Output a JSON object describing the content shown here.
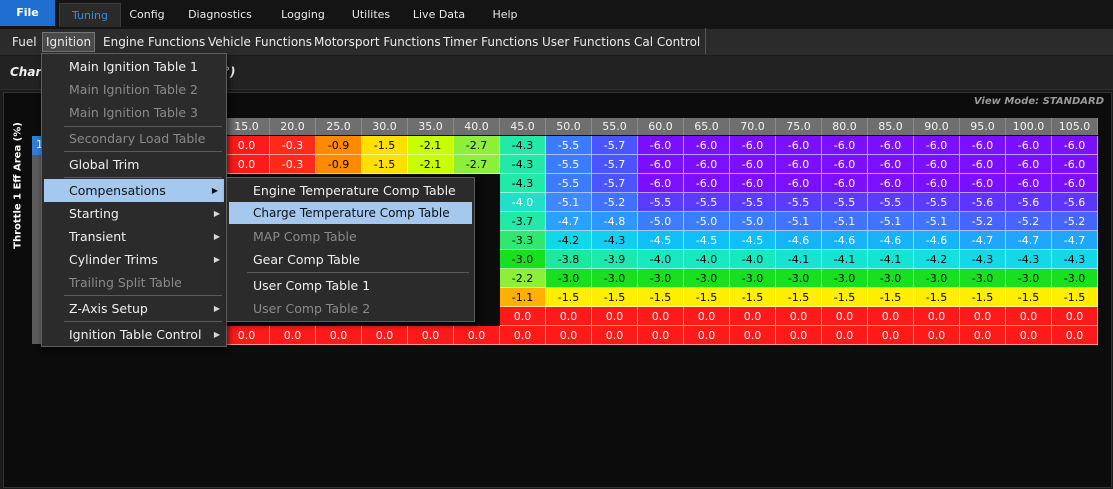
{
  "topbar": {
    "tabs": [
      {
        "label": "File",
        "name": "file"
      },
      {
        "label": "Tuning",
        "name": "tuning"
      },
      {
        "label": "Config",
        "name": "config"
      },
      {
        "label": "Diagnostics",
        "name": "diagnostics"
      },
      {
        "label": "Logging",
        "name": "logging"
      },
      {
        "label": "Utilites",
        "name": "utilites"
      },
      {
        "label": "Live Data",
        "name": "live-data"
      },
      {
        "label": "Help",
        "name": "help"
      }
    ],
    "active": "Tuning"
  },
  "submenu": {
    "items": [
      "Fuel",
      "Ignition",
      "Engine Functions",
      "Vehicle Functions",
      "Motorsport Functions",
      "Timer Functions",
      "User Functions",
      "Cal Control"
    ],
    "selected": "Ignition"
  },
  "header": {
    "title_partial": "Charg",
    "title_tail": "°)",
    "view_mode": "View Mode: STANDARD",
    "y_axis_label": "Throttle 1 Eff Area (%)"
  },
  "ignition_menu": {
    "items": [
      {
        "label": "Main Ignition Table 1",
        "disabled": false,
        "submenu": false
      },
      {
        "label": "Main Ignition Table 2",
        "disabled": true,
        "submenu": false
      },
      {
        "label": "Main Ignition Table 3",
        "disabled": true,
        "submenu": false
      },
      {
        "label": "Secondary Load Table",
        "disabled": true,
        "submenu": false
      },
      {
        "label": "Global Trim",
        "disabled": false,
        "submenu": false
      },
      {
        "label": "Compensations",
        "disabled": false,
        "submenu": true,
        "highlighted": true
      },
      {
        "label": "Starting",
        "disabled": false,
        "submenu": true
      },
      {
        "label": "Transient",
        "disabled": false,
        "submenu": true
      },
      {
        "label": "Cylinder Trims",
        "disabled": false,
        "submenu": true
      },
      {
        "label": "Trailing Split Table",
        "disabled": true,
        "submenu": false
      },
      {
        "label": "Z-Axis Setup",
        "disabled": false,
        "submenu": true
      },
      {
        "label": "Ignition Table Control",
        "disabled": false,
        "submenu": true
      }
    ]
  },
  "compensations_menu": {
    "items": [
      {
        "label": "Engine Temperature Comp Table",
        "disabled": false
      },
      {
        "label": "Charge Temperature Comp Table",
        "disabled": false,
        "highlighted": true
      },
      {
        "label": "MAP Comp Table",
        "disabled": true
      },
      {
        "label": "Gear Comp Table",
        "disabled": false
      },
      {
        "label": "User Comp Table 1",
        "disabled": false
      },
      {
        "label": "User Comp Table 2",
        "disabled": true
      }
    ]
  },
  "table": {
    "row_header_first": "1",
    "col_headers": [
      "15.0",
      "20.0",
      "25.0",
      "30.0",
      "35.0",
      "40.0",
      "45.0",
      "50.0",
      "55.0",
      "60.0",
      "65.0",
      "70.0",
      "75.0",
      "80.0",
      "85.0",
      "90.0",
      "95.0",
      "100.0",
      "105.0"
    ],
    "rows": [
      {
        "values": [
          "0.0",
          "-0.3",
          "-0.9",
          "-1.5",
          "-2.1",
          "-2.7",
          "-4.3",
          "-5.5",
          "-5.7",
          "-6.0",
          "-6.0",
          "-6.0",
          "-6.0",
          "-6.0",
          "-6.0",
          "-6.0",
          "-6.0",
          "-6.0",
          "-6.0"
        ],
        "colors": [
          "#ff1a1a",
          "#ff2a1a",
          "#ff8a00",
          "#ffe000",
          "#c7ff00",
          "#8cf03a",
          "#22e8a8",
          "#3b7cff",
          "#4a55ff",
          "#7a10ff",
          "#7a10ff",
          "#7a10ff",
          "#7a10ff",
          "#7a10ff",
          "#7a10ff",
          "#7a10ff",
          "#7a10ff",
          "#7a10ff",
          "#7a10ff"
        ]
      },
      {
        "values": [
          "0.0",
          "-0.3",
          "-0.9",
          "-1.5",
          "-2.1",
          "-2.7",
          "-4.3",
          "-5.5",
          "-5.7",
          "-6.0",
          "-6.0",
          "-6.0",
          "-6.0",
          "-6.0",
          "-6.0",
          "-6.0",
          "-6.0",
          "-6.0",
          "-6.0"
        ],
        "colors": [
          "#ff1a1a",
          "#ff2a1a",
          "#ff8a00",
          "#ffe000",
          "#c7ff00",
          "#8cf03a",
          "#22e8a8",
          "#3b7cff",
          "#4a55ff",
          "#7a10ff",
          "#7a10ff",
          "#7a10ff",
          "#7a10ff",
          "#7a10ff",
          "#7a10ff",
          "#7a10ff",
          "#7a10ff",
          "#7a10ff",
          "#7a10ff"
        ]
      },
      {
        "values": [
          "",
          "",
          "",
          "",
          "",
          "",
          "-4.3",
          "-5.5",
          "-5.7",
          "-6.0",
          "-6.0",
          "-6.0",
          "-6.0",
          "-6.0",
          "-6.0",
          "-6.0",
          "-6.0",
          "-6.0",
          "-6.0"
        ],
        "colors": [
          "",
          "",
          "",
          "",
          "",
          "",
          "#22e8a8",
          "#3b7cff",
          "#4a55ff",
          "#7a10ff",
          "#7a10ff",
          "#7a10ff",
          "#7a10ff",
          "#7a10ff",
          "#7a10ff",
          "#7a10ff",
          "#7a10ff",
          "#7a10ff",
          "#7a10ff"
        ]
      },
      {
        "values": [
          "",
          "",
          "",
          "",
          "",
          "",
          "-4.0",
          "-5.1",
          "-5.2",
          "-5.5",
          "-5.5",
          "-5.5",
          "-5.5",
          "-5.5",
          "-5.5",
          "-5.5",
          "-5.6",
          "-5.6",
          "-5.6"
        ],
        "colors": [
          "",
          "",
          "",
          "",
          "",
          "",
          "#20e0c8",
          "#3f88ff",
          "#4172ff",
          "#5a3cff",
          "#5a3cff",
          "#5a3cff",
          "#5a3cff",
          "#5a3cff",
          "#5a3cff",
          "#5a3cff",
          "#5c35ff",
          "#5c35ff",
          "#5c35ff"
        ]
      },
      {
        "values": [
          "",
          "",
          "",
          "",
          "",
          "",
          "-3.7",
          "-4.7",
          "-4.8",
          "-5.0",
          "-5.0",
          "-5.0",
          "-5.1",
          "-5.1",
          "-5.1",
          "-5.1",
          "-5.2",
          "-5.2",
          "-5.2"
        ],
        "colors": [
          "",
          "",
          "",
          "",
          "",
          "",
          "#22e8a8",
          "#2aa0ff",
          "#2c98ff",
          "#3a7dff",
          "#3a7dff",
          "#3a7dff",
          "#3f74ff",
          "#3f74ff",
          "#3f74ff",
          "#3f74ff",
          "#4466ff",
          "#4466ff",
          "#4466ff"
        ]
      },
      {
        "values": [
          "",
          "",
          "",
          "",
          "",
          "",
          "-3.3",
          "-4.2",
          "-4.3",
          "-4.5",
          "-4.5",
          "-4.5",
          "-4.6",
          "-4.6",
          "-4.6",
          "-4.6",
          "-4.7",
          "-4.7",
          "-4.7"
        ],
        "colors": [
          "",
          "",
          "",
          "",
          "",
          "",
          "#30e870",
          "#10d8e8",
          "#12cfef",
          "#10bff5",
          "#10bff5",
          "#10bff5",
          "#18b2f8",
          "#18b2f8",
          "#18b2f8",
          "#18b2f8",
          "#20a6fb",
          "#20a6fb",
          "#20a6fb"
        ]
      },
      {
        "values": [
          "",
          "",
          "",
          "",
          "",
          "",
          "-3.0",
          "-3.8",
          "-3.9",
          "-4.0",
          "-4.0",
          "-4.0",
          "-4.1",
          "-4.1",
          "-4.1",
          "-4.2",
          "-4.3",
          "-4.3",
          "-4.3"
        ],
        "colors": [
          "",
          "",
          "",
          "",
          "",
          "",
          "#18e020",
          "#1de8a0",
          "#1ce8b0",
          "#18e8c0",
          "#18e8c0",
          "#18e8c0",
          "#15e4d0",
          "#15e4d0",
          "#15e4d0",
          "#14e0e0",
          "#12d8e8",
          "#12d8e8",
          "#12d8e8"
        ]
      },
      {
        "values": [
          "",
          "",
          "",
          "",
          "",
          "",
          "-2.2",
          "-3.0",
          "-3.0",
          "-3.0",
          "-3.0",
          "-3.0",
          "-3.0",
          "-3.0",
          "-3.0",
          "-3.0",
          "-3.0",
          "-3.0",
          "-3.0"
        ],
        "colors": [
          "",
          "",
          "",
          "",
          "",
          "",
          "#8cf03a",
          "#18e020",
          "#18e020",
          "#18e020",
          "#18e020",
          "#18e020",
          "#18e020",
          "#18e020",
          "#18e020",
          "#18e020",
          "#18e020",
          "#18e020",
          "#18e020"
        ]
      },
      {
        "values": [
          "",
          "",
          "",
          "",
          "",
          "",
          "-1.1",
          "-1.5",
          "-1.5",
          "-1.5",
          "-1.5",
          "-1.5",
          "-1.5",
          "-1.5",
          "-1.5",
          "-1.5",
          "-1.5",
          "-1.5",
          "-1.5"
        ],
        "colors": [
          "",
          "",
          "",
          "",
          "",
          "",
          "#ffb000",
          "#ffee00",
          "#ffee00",
          "#ffee00",
          "#ffee00",
          "#ffee00",
          "#ffee00",
          "#ffee00",
          "#ffee00",
          "#ffee00",
          "#ffee00",
          "#ffee00",
          "#ffee00"
        ]
      },
      {
        "values": [
          "",
          "",
          "",
          "",
          "",
          "",
          "0.0",
          "0.0",
          "0.0",
          "0.0",
          "0.0",
          "0.0",
          "0.0",
          "0.0",
          "0.0",
          "0.0",
          "0.0",
          "0.0",
          "0.0"
        ],
        "colors": [
          "",
          "",
          "",
          "",
          "",
          "",
          "#ff1a1a",
          "#ff1a1a",
          "#ff1a1a",
          "#ff1a1a",
          "#ff1a1a",
          "#ff1a1a",
          "#ff1a1a",
          "#ff1a1a",
          "#ff1a1a",
          "#ff1a1a",
          "#ff1a1a",
          "#ff1a1a",
          "#ff1a1a"
        ]
      },
      {
        "values": [
          "0.0",
          "0.0",
          "0.0",
          "0.0",
          "0.0",
          "0.0",
          "0.0",
          "0.0",
          "0.0",
          "0.0",
          "0.0",
          "0.0",
          "0.0",
          "0.0",
          "0.0",
          "0.0",
          "0.0",
          "0.0",
          "0.0"
        ],
        "colors": [
          "#ff1a1a",
          "#ff1a1a",
          "#ff1a1a",
          "#ff1a1a",
          "#ff1a1a",
          "#ff1a1a",
          "#ff1a1a",
          "#ff1a1a",
          "#ff1a1a",
          "#ff1a1a",
          "#ff1a1a",
          "#ff1a1a",
          "#ff1a1a",
          "#ff1a1a",
          "#ff1a1a",
          "#ff1a1a",
          "#ff1a1a",
          "#ff1a1a",
          "#ff1a1a"
        ]
      }
    ]
  },
  "colors": {
    "accent": "#1f6fd1",
    "menu_highlight": "#a4c8ee",
    "header_bg": "#6f6f6f"
  }
}
